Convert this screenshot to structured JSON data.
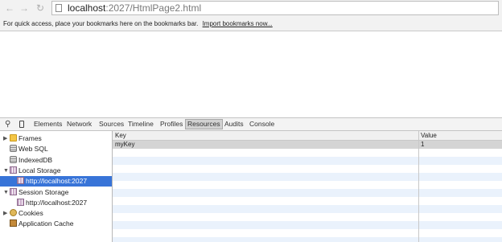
{
  "browser": {
    "url_host": "localhost",
    "url_rest": ":2027/HtmlPage2.html"
  },
  "bookmarks_bar": {
    "message": "For quick access, place your bookmarks here on the bookmarks bar.",
    "import_link": "Import bookmarks now..."
  },
  "devtools": {
    "tabs": [
      "Elements",
      "Network",
      "Sources",
      "Timeline",
      "Profiles",
      "Resources",
      "Audits",
      "Console"
    ],
    "selected_tab": "Resources",
    "sidebar": {
      "frames": "Frames",
      "web_sql": "Web SQL",
      "indexeddb": "IndexedDB",
      "local_storage": "Local Storage",
      "local_storage_origin": "http://localhost:2027",
      "session_storage": "Session Storage",
      "session_storage_origin": "http://localhost:2027",
      "cookies": "Cookies",
      "application_cache": "Application Cache"
    },
    "table": {
      "columns": [
        "Key",
        "Value"
      ],
      "rows": [
        {
          "key": "myKey",
          "value": "1"
        }
      ]
    }
  }
}
